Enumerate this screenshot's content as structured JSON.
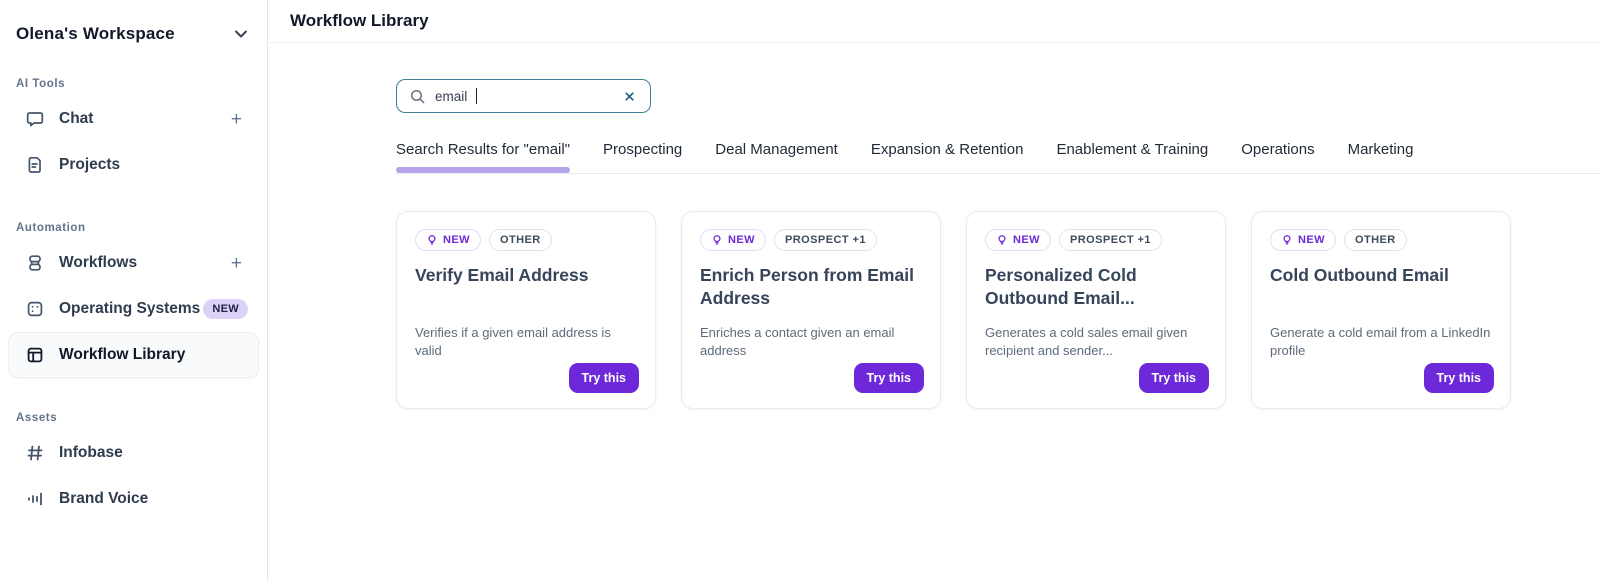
{
  "workspace": {
    "name": "Olena's Workspace"
  },
  "sidebar": {
    "sections": [
      {
        "label": "AI Tools",
        "items": [
          {
            "label": "Chat",
            "icon": "chat-icon",
            "action": "+"
          },
          {
            "label": "Projects",
            "icon": "document-icon"
          }
        ]
      },
      {
        "label": "Automation",
        "items": [
          {
            "label": "Workflows",
            "icon": "workflow-nodes-icon",
            "action": "+"
          },
          {
            "label": "Operating Systems",
            "icon": "grid-dots-icon",
            "badge": "NEW"
          },
          {
            "label": "Workflow Library",
            "icon": "layout-icon",
            "active": true
          }
        ]
      },
      {
        "label": "Assets",
        "items": [
          {
            "label": "Infobase",
            "icon": "hash-icon"
          },
          {
            "label": "Brand Voice",
            "icon": "waveform-icon"
          }
        ]
      }
    ]
  },
  "header": {
    "title": "Workflow Library"
  },
  "search": {
    "value": "email"
  },
  "tabs": [
    {
      "label": "Search Results for \"email\"",
      "active": true
    },
    {
      "label": "Prospecting"
    },
    {
      "label": "Deal Management"
    },
    {
      "label": "Expansion & Retention"
    },
    {
      "label": "Enablement & Training"
    },
    {
      "label": "Operations"
    },
    {
      "label": "Marketing"
    }
  ],
  "cards": [
    {
      "badges": [
        {
          "label": "NEW",
          "type": "new"
        },
        {
          "label": "OTHER",
          "type": "category"
        }
      ],
      "title": "Verify Email Address",
      "description": "Verifies if a given email address is valid",
      "cta": "Try this"
    },
    {
      "badges": [
        {
          "label": "NEW",
          "type": "new"
        },
        {
          "label": "PROSPECT +1",
          "type": "category"
        }
      ],
      "title": "Enrich Person from Email Address",
      "description": "Enriches a contact given an email address",
      "cta": "Try this"
    },
    {
      "badges": [
        {
          "label": "NEW",
          "type": "new"
        },
        {
          "label": "PROSPECT +1",
          "type": "category"
        }
      ],
      "title": "Personalized Cold Outbound Email...",
      "description": "Generates a cold sales email given recipient and sender...",
      "cta": "Try this"
    },
    {
      "badges": [
        {
          "label": "NEW",
          "type": "new"
        },
        {
          "label": "OTHER",
          "type": "category"
        }
      ],
      "title": "Cold Outbound Email",
      "description": "Generate a cold email from a LinkedIn profile",
      "cta": "Try this"
    }
  ],
  "colors": {
    "accent": "#6d28d9",
    "tab-indicator": "#b7a5ec",
    "search-border": "#3f8096",
    "new-badge-bg": "#dcd2f8",
    "new-badge-text": "#232145"
  }
}
